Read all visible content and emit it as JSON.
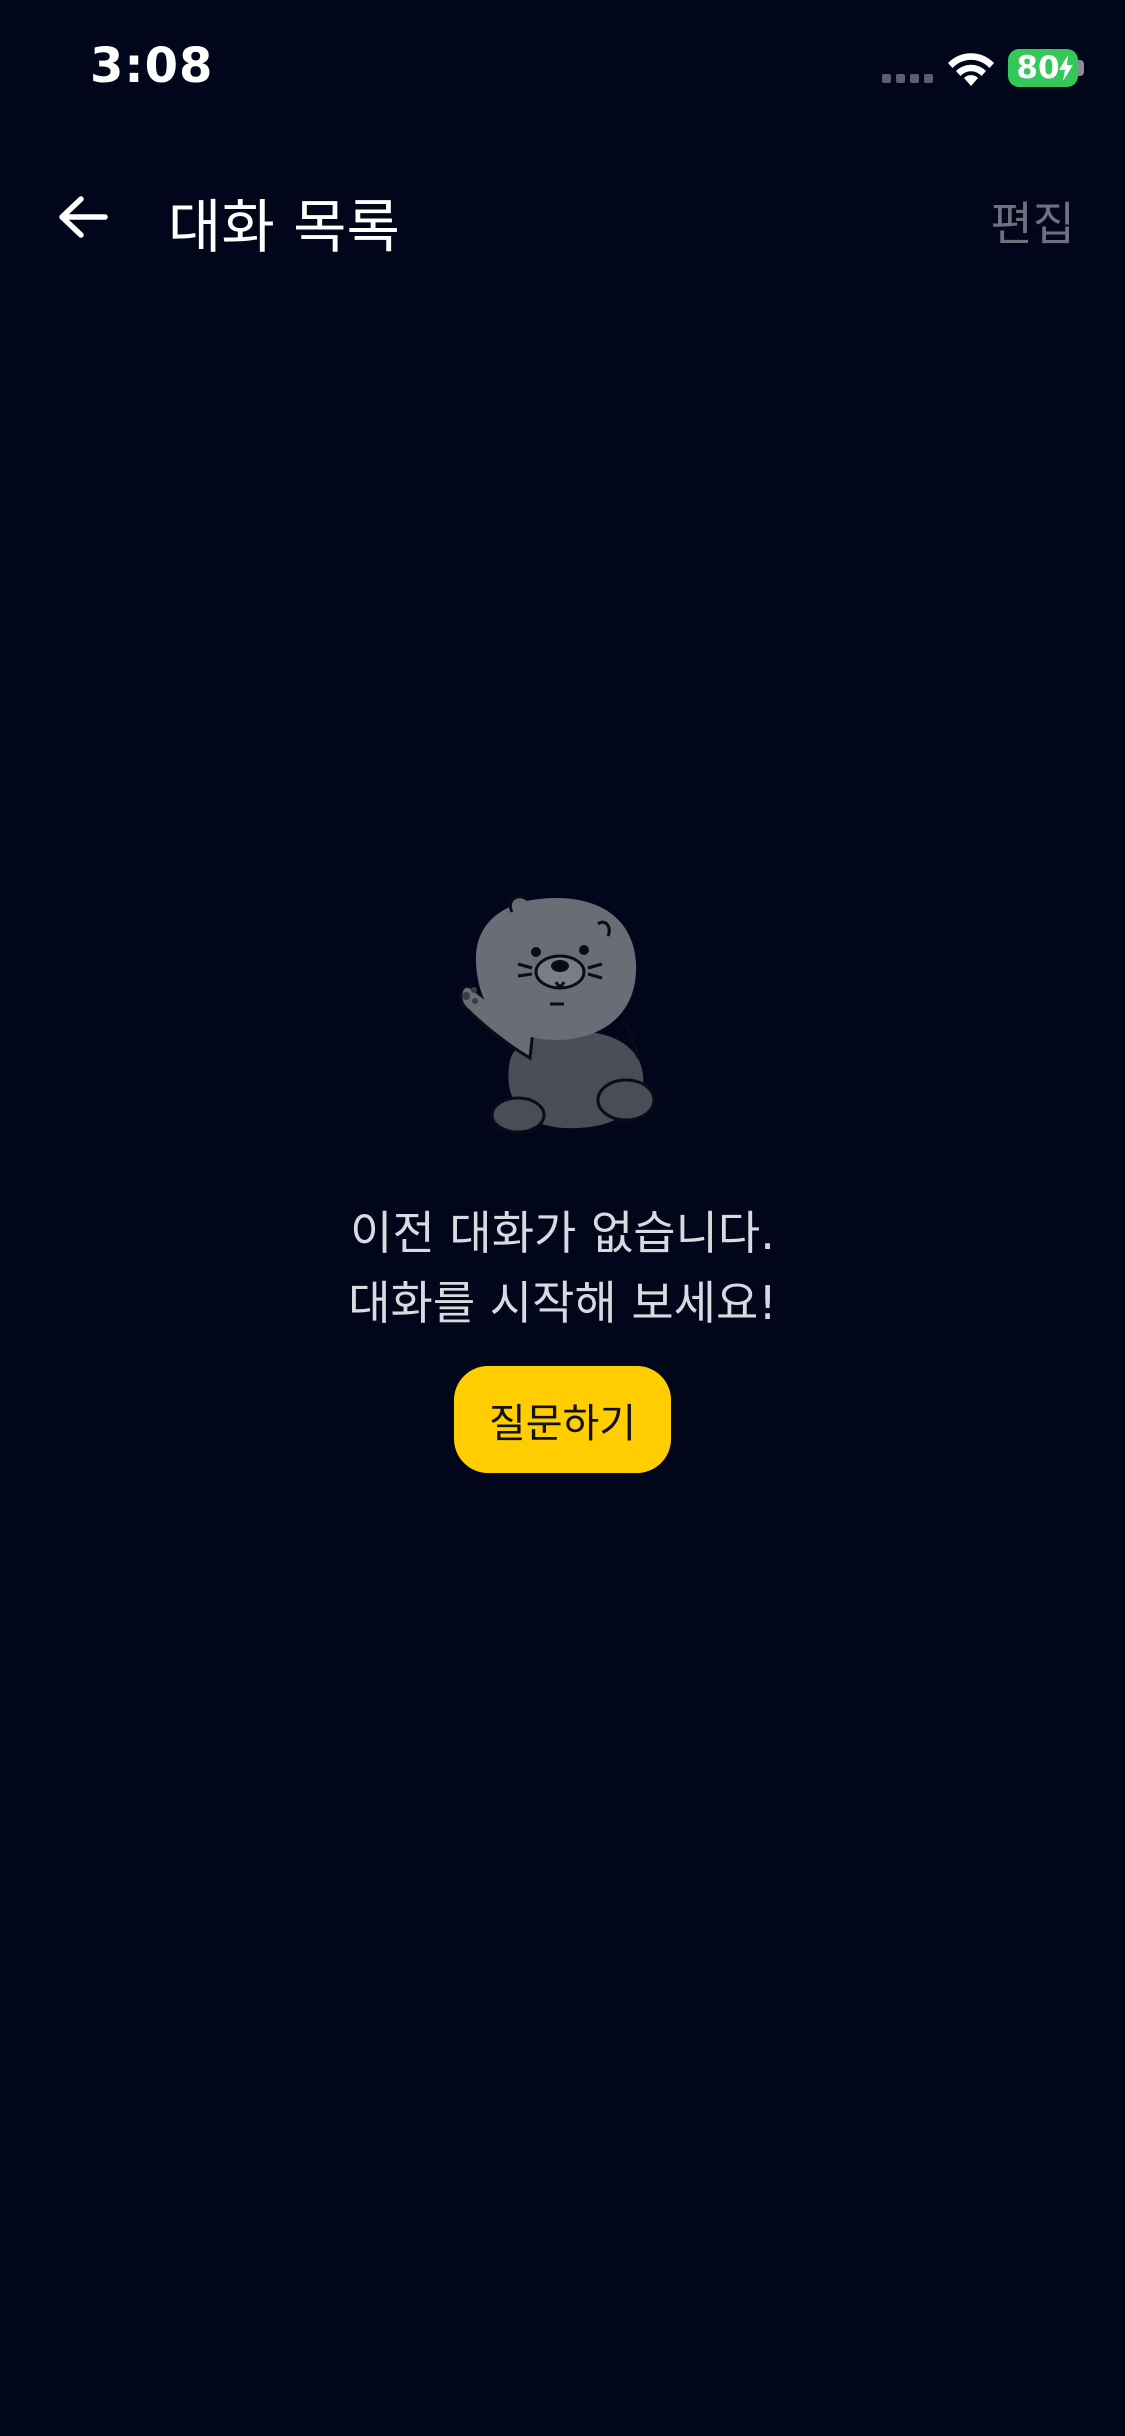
{
  "status_bar": {
    "time": "3:08",
    "battery_level": "80",
    "battery_color": "#34C759"
  },
  "header": {
    "back_icon": "arrow-left-icon",
    "title": "대화 목록",
    "edit_label": "편집"
  },
  "empty_state": {
    "illustration": "waving-bear-character",
    "message_line1": "이전 대화가 없습니다.",
    "message_line2": "대화를 시작해 보세요!",
    "ask_button_label": "질문하기",
    "ask_button_color": "#FFCD00"
  },
  "colors": {
    "background": "#01061A",
    "muted_text": "#6E717C"
  }
}
